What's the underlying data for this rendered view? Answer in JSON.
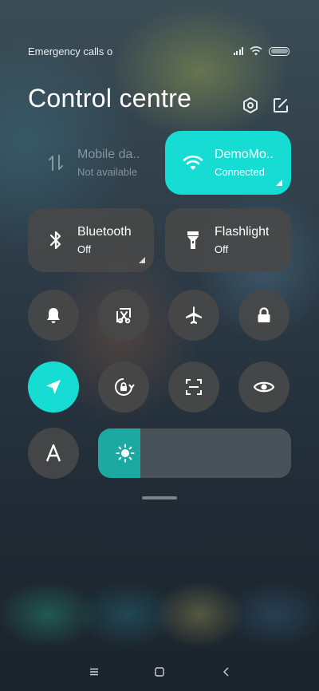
{
  "status_bar": {
    "carrier_text": "Emergency calls o",
    "icons": [
      "signal-icon",
      "wifi-icon",
      "battery-icon"
    ]
  },
  "header": {
    "title": "Control centre",
    "icons": [
      "settings-icon",
      "edit-icon"
    ]
  },
  "tiles": {
    "mobile_data": {
      "label": "Mobile da..",
      "status": "Not available",
      "state": "disabled",
      "icon": "mobile-data-icon"
    },
    "wifi": {
      "label": "DemoMo..",
      "status": "Connected",
      "state": "on",
      "icon": "wifi-icon"
    },
    "bluetooth": {
      "label": "Bluetooth",
      "status": "Off",
      "state": "off",
      "icon": "bluetooth-icon"
    },
    "flashlight": {
      "label": "Flashlight",
      "status": "Off",
      "state": "off",
      "icon": "flashlight-icon"
    }
  },
  "toggles": [
    {
      "icon": "bell-icon",
      "state": "off"
    },
    {
      "icon": "screenshot-icon",
      "state": "off"
    },
    {
      "icon": "airplane-icon",
      "state": "off"
    },
    {
      "icon": "lock-icon",
      "state": "off"
    },
    {
      "icon": "location-icon",
      "state": "on"
    },
    {
      "icon": "rotation-lock-icon",
      "state": "off"
    },
    {
      "icon": "scan-icon",
      "state": "off"
    },
    {
      "icon": "eye-icon",
      "state": "off"
    },
    {
      "icon": "font-icon",
      "label": "A",
      "state": "off"
    }
  ],
  "brightness": {
    "icon": "sun-icon",
    "level": 0.22
  },
  "navigation": [
    "menu-icon",
    "home-icon",
    "back-icon"
  ],
  "colors": {
    "accent": "#17dcd3",
    "tile_dark": "#484848",
    "brightness_fill": "#1ba9a2"
  }
}
